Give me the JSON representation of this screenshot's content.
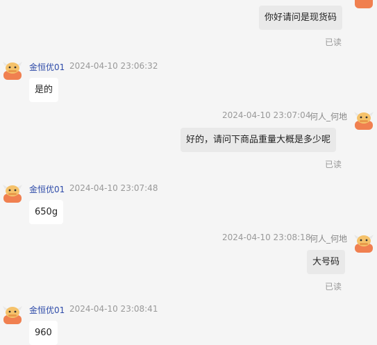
{
  "conversation": {
    "messages": [
      {
        "direction": "out",
        "text": "你好请问是现货码",
        "read": "已读"
      },
      {
        "direction": "in",
        "sender": "金恒优01",
        "time": "2024-04-10 23:06:32",
        "text": "是的"
      },
      {
        "direction": "out",
        "sender": "何人_何地",
        "time": "2024-04-10 23:07:04",
        "text": "好的，请问下商品重量大概是多少呢",
        "read": "已读"
      },
      {
        "direction": "in",
        "sender": "金恒优01",
        "time": "2024-04-10 23:07:48",
        "text": "650g"
      },
      {
        "direction": "out",
        "sender": "何人_何地",
        "time": "2024-04-10 23:08:18",
        "text": "大号码",
        "read": "已读"
      },
      {
        "direction": "in",
        "sender": "金恒优01",
        "time": "2024-04-10 23:08:41",
        "text": "960"
      }
    ]
  },
  "icons": {
    "avatar": "cartoon-bull-avatar-icon"
  },
  "colors": {
    "avatar_orange": "#f08050",
    "sender_name": "#2d4aa8",
    "incoming_bubble": "#ffffff",
    "outgoing_bubble": "#e9e9e9"
  }
}
